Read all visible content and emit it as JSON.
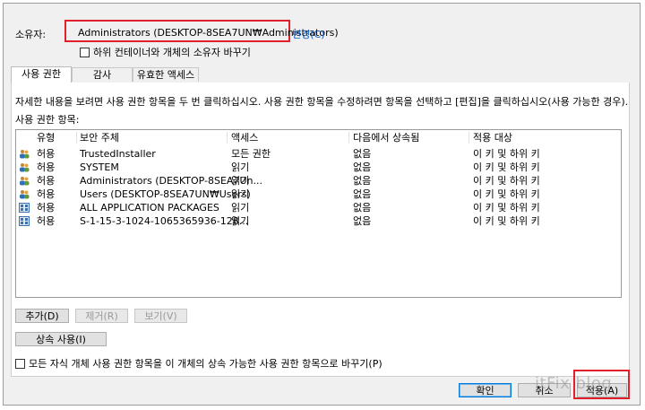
{
  "owner": {
    "label": "소유자:",
    "value": "Administrators (DESKTOP-8SEA7UN₩Administrators)",
    "change_link": "변경(C)"
  },
  "replace_owner_checkbox": {
    "label": "하위 컨테이너와 개체의 소유자 바꾸기",
    "checked": false
  },
  "tabs": [
    {
      "label": "사용 권한",
      "active": true
    },
    {
      "label": "감사",
      "active": false
    },
    {
      "label": "유효한 액세스",
      "active": false
    }
  ],
  "instructions": "자세한 내용을 보려면 사용 권한 항목을 두 번 클릭하십시오. 사용 권한 항목을 수정하려면 항목을 선택하고 [편집]을 클릭하십시오(사용 가능한 경우).",
  "list_label": "사용 권한 항목:",
  "columns": [
    "유형",
    "보안 주체",
    "액세스",
    "다음에서 상속됨",
    "적용 대상"
  ],
  "entries": [
    {
      "icon": "users-icon",
      "type": "허용",
      "principal": "TrustedInstaller",
      "access": "모든 권한",
      "inherited_from": "없음",
      "applies_to": "이 키 및 하위 키"
    },
    {
      "icon": "users-icon",
      "type": "허용",
      "principal": "SYSTEM",
      "access": "읽기",
      "inherited_from": "없음",
      "applies_to": "이 키 및 하위 키"
    },
    {
      "icon": "users-icon",
      "type": "허용",
      "principal": "Administrators (DESKTOP-8SEA7Un...",
      "access": "읽기",
      "inherited_from": "없음",
      "applies_to": "이 키 및 하위 키"
    },
    {
      "icon": "users-icon",
      "type": "허용",
      "principal": "Users (DESKTOP-8SEA7UN₩Users)",
      "access": "읽기",
      "inherited_from": "없음",
      "applies_to": "이 키 및 하위 키"
    },
    {
      "icon": "package-icon",
      "type": "허용",
      "principal": "ALL APPLICATION PACKAGES",
      "access": "읽기",
      "inherited_from": "없음",
      "applies_to": "이 키 및 하위 키"
    },
    {
      "icon": "package-icon",
      "type": "허용",
      "principal": "S-1-15-3-1024-1065365936-128...",
      "access": "읽기",
      "inherited_from": "없음",
      "applies_to": "이 키 및 하위 키"
    }
  ],
  "buttons": {
    "add": "추가(D)",
    "remove": "제거(R)",
    "view": "보기(V)",
    "inheritance": "상속 사용(I)",
    "ok": "확인",
    "cancel": "취소",
    "apply": "적용(A)"
  },
  "replace_child_checkbox": {
    "label": "모든 자식 개체 사용 권한 항목을 이 개체의 상속 가능한 사용 권한 항목으로 바꾸기(P)",
    "checked": false
  },
  "watermark": "itFix blog",
  "colors": {
    "highlight": "#e0202c",
    "link": "#0a57c4",
    "dialog_bg": "#f0f0f0"
  }
}
